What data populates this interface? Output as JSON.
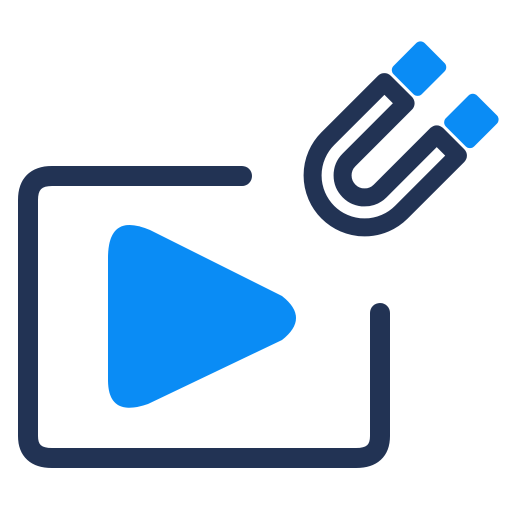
{
  "icon": {
    "name": "video-magnet-icon",
    "colors": {
      "outline": "#223354",
      "accent": "#0A8CF5",
      "background": "#FFFFFF"
    },
    "parts": [
      "video-frame-icon",
      "play-icon",
      "magnet-icon"
    ]
  }
}
